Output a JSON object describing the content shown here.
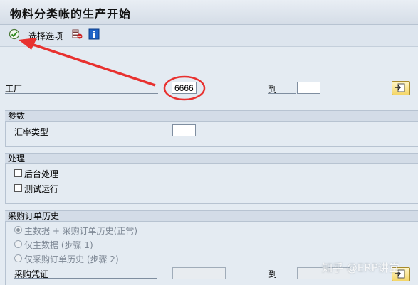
{
  "title": "物料分类帐的生产开始",
  "toolbar": {
    "select_options_label": "选择选项"
  },
  "plant": {
    "label": "工厂",
    "value": "6666",
    "to_label": "到",
    "to_value": ""
  },
  "params": {
    "header": "参数",
    "exchange_rate_type_label": "汇率类型",
    "exchange_rate_type_value": ""
  },
  "processing": {
    "header": "处理",
    "background_label": "后台处理",
    "test_run_label": "测试运行"
  },
  "po_history": {
    "header": "采购订单历史",
    "options": [
      "主数据 + 采购订单历史(正常)",
      "仅主数据 (步骤 1)",
      "仅采购订单历史 (步骤 2)"
    ],
    "selected_index": 0,
    "doc_label": "采购凭证",
    "doc_to_label": "到"
  },
  "watermark": "知乎 @ERP讲堂",
  "colors": {
    "annotation_red": "#e8312f"
  }
}
